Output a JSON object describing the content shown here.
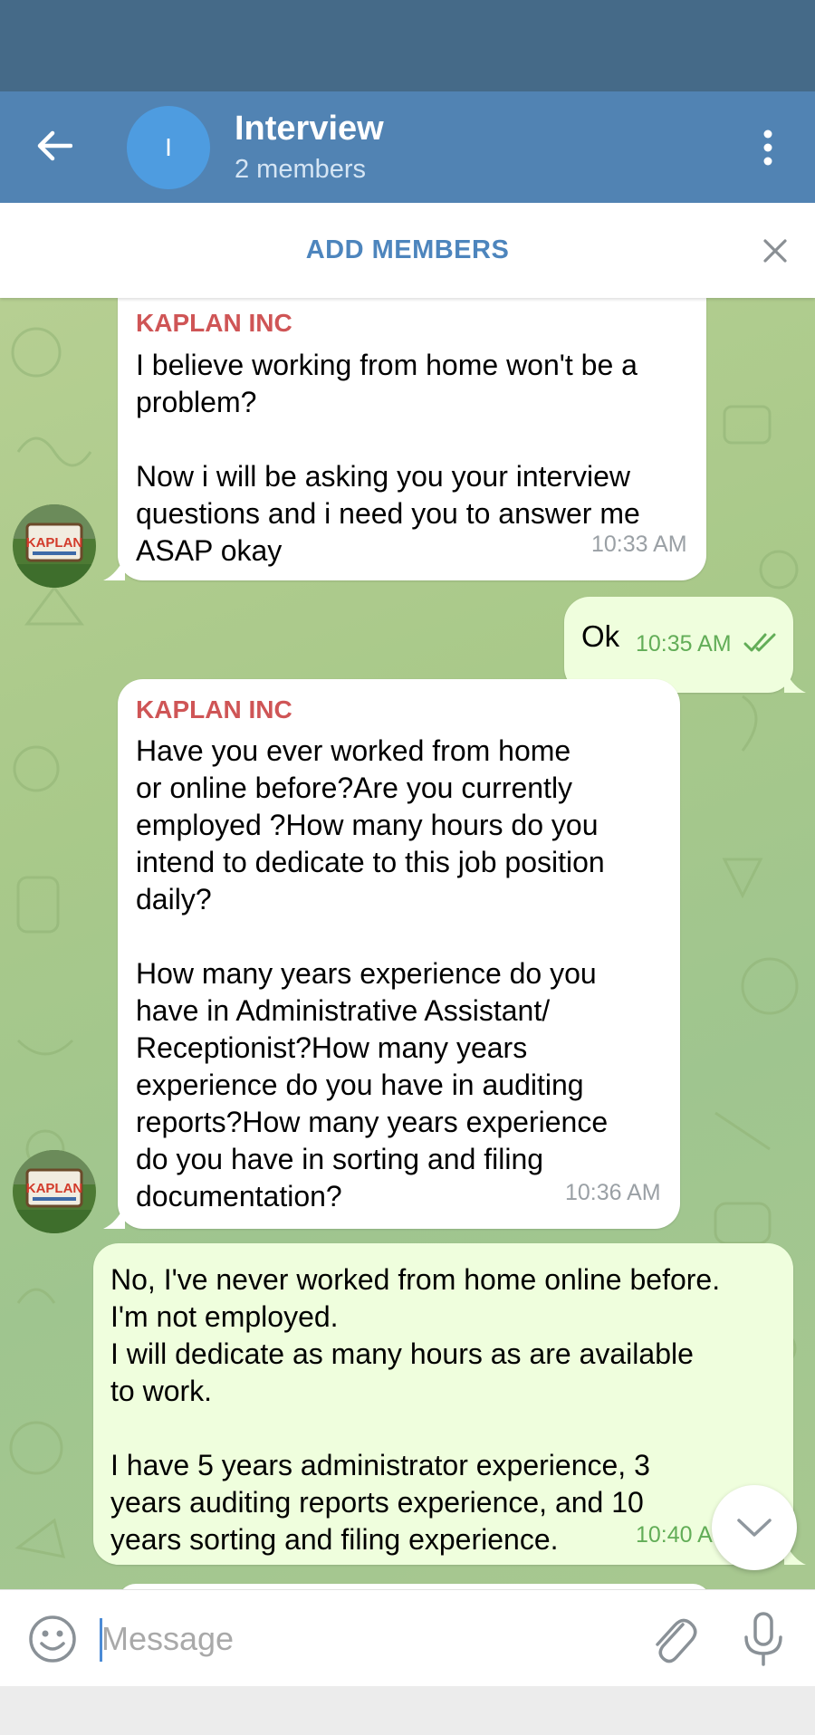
{
  "header": {
    "title": "Interview",
    "subtitle": "2 members",
    "avatar_letter": "I"
  },
  "banner": {
    "add_members_label": "ADD MEMBERS"
  },
  "messages": [
    {
      "direction": "incoming",
      "sender": "KAPLAN INC",
      "text": "I believe working from home won't be a problem?\n\nNow i will be asking you your interview questions and i need you to answer me ASAP okay",
      "time": "10:33 AM"
    },
    {
      "direction": "outgoing",
      "text": "Ok",
      "time": "10:35 AM",
      "status": "read"
    },
    {
      "direction": "incoming",
      "sender": "KAPLAN INC",
      "text": "Have you ever worked from home\nor online before?Are you currently\nemployed ?How many hours do you\nintend to dedicate to this job position\ndaily?\n\nHow many years experience do you\nhave in Administrative Assistant/\nReceptionist?How many years\nexperience do you have in auditing\nreports?How many years experience\ndo you have in sorting and filing\ndocumentation?",
      "time": "10:36 AM"
    },
    {
      "direction": "outgoing",
      "text": "No, I've never worked from home online before.\nI'm not employed.\nI will dedicate as many hours as are available\nto work.\n\nI have 5 years administrator experience, 3\nyears auditing reports experience, and 10\nyears sorting and filing experience.",
      "time": "10:40 A"
    }
  ],
  "input": {
    "placeholder": "Message"
  },
  "avatar_sign_text": "KAPLAN",
  "colors": {
    "status_bar": "#456a88",
    "app_bar": "#5183b3",
    "accent_link": "#4d85bd",
    "sender_name": "#cf5556",
    "outgoing_bubble": "#effedd",
    "outgoing_time": "#62ad57"
  },
  "icons": {
    "back": "arrow-left-icon",
    "menu": "more-vertical-icon",
    "close": "close-icon",
    "read_status": "double-check-icon",
    "scroll_down": "chevron-down-icon",
    "emoji": "smiley-icon",
    "attach": "paperclip-icon",
    "mic": "microphone-icon"
  }
}
